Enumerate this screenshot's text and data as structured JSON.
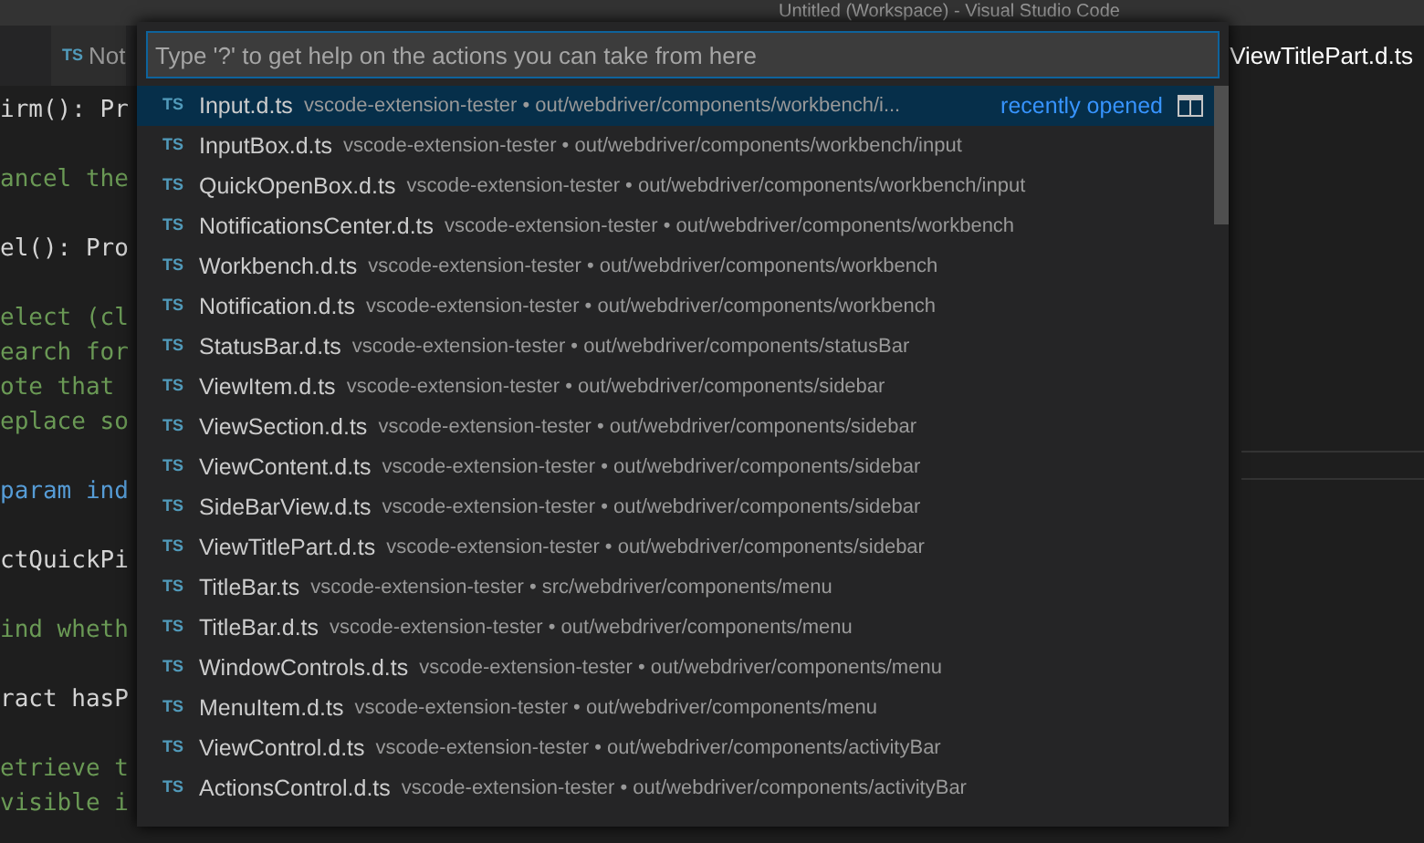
{
  "window": {
    "title": "Untitled (Workspace) - Visual Studio Code"
  },
  "tabs": [
    {
      "icon": "TS",
      "label": "Not",
      "selected": false
    },
    {
      "label": "ViewTitlePart.d.ts",
      "selected": true
    }
  ],
  "editor": {
    "blocks": [
      [
        {
          "text": "irm(): Pr",
          "kind": "code"
        }
      ],
      [
        {
          "text": "ancel the",
          "kind": "comment"
        }
      ],
      [
        {
          "text": "el(): Pro",
          "kind": "code"
        }
      ],
      [
        {
          "text": "elect (cl",
          "kind": "comment"
        },
        {
          "text": "earch for",
          "kind": "comment"
        },
        {
          "text": "ote that",
          "kind": "comment"
        },
        {
          "text": "eplace so",
          "kind": "comment"
        }
      ],
      [
        {
          "text": "param ind",
          "kind": "jsdoc"
        }
      ],
      [
        {
          "text": "ctQuickPi",
          "kind": "code"
        }
      ],
      [
        {
          "text": "ind wheth",
          "kind": "comment"
        }
      ],
      [
        {
          "text": "ract hasP",
          "kind": "code"
        }
      ],
      [
        {
          "text": "etrieve t",
          "kind": "comment"
        },
        {
          "text": "visible i",
          "kind": "comment"
        }
      ]
    ]
  },
  "quick_open": {
    "placeholder": "Type '?' to get help on the actions you can take from here",
    "items": [
      {
        "icon": "TS",
        "name": "Input.d.ts",
        "description": "vscode-extension-tester • out/webdriver/components/workbench/i...",
        "detail": "recently opened",
        "selected": true
      },
      {
        "icon": "TS",
        "name": "InputBox.d.ts",
        "description": "vscode-extension-tester • out/webdriver/components/workbench/input",
        "selected": false
      },
      {
        "icon": "TS",
        "name": "QuickOpenBox.d.ts",
        "description": "vscode-extension-tester • out/webdriver/components/workbench/input",
        "selected": false
      },
      {
        "icon": "TS",
        "name": "NotificationsCenter.d.ts",
        "description": "vscode-extension-tester • out/webdriver/components/workbench",
        "selected": false
      },
      {
        "icon": "TS",
        "name": "Workbench.d.ts",
        "description": "vscode-extension-tester • out/webdriver/components/workbench",
        "selected": false
      },
      {
        "icon": "TS",
        "name": "Notification.d.ts",
        "description": "vscode-extension-tester • out/webdriver/components/workbench",
        "selected": false
      },
      {
        "icon": "TS",
        "name": "StatusBar.d.ts",
        "description": "vscode-extension-tester • out/webdriver/components/statusBar",
        "selected": false
      },
      {
        "icon": "TS",
        "name": "ViewItem.d.ts",
        "description": "vscode-extension-tester • out/webdriver/components/sidebar",
        "selected": false
      },
      {
        "icon": "TS",
        "name": "ViewSection.d.ts",
        "description": "vscode-extension-tester • out/webdriver/components/sidebar",
        "selected": false
      },
      {
        "icon": "TS",
        "name": "ViewContent.d.ts",
        "description": "vscode-extension-tester • out/webdriver/components/sidebar",
        "selected": false
      },
      {
        "icon": "TS",
        "name": "SideBarView.d.ts",
        "description": "vscode-extension-tester • out/webdriver/components/sidebar",
        "selected": false
      },
      {
        "icon": "TS",
        "name": "ViewTitlePart.d.ts",
        "description": "vscode-extension-tester • out/webdriver/components/sidebar",
        "selected": false
      },
      {
        "icon": "TS",
        "name": "TitleBar.ts",
        "description": "vscode-extension-tester • src/webdriver/components/menu",
        "selected": false
      },
      {
        "icon": "TS",
        "name": "TitleBar.d.ts",
        "description": "vscode-extension-tester • out/webdriver/components/menu",
        "selected": false
      },
      {
        "icon": "TS",
        "name": "WindowControls.d.ts",
        "description": "vscode-extension-tester • out/webdriver/components/menu",
        "selected": false
      },
      {
        "icon": "TS",
        "name": "MenuItem.d.ts",
        "description": "vscode-extension-tester • out/webdriver/components/menu",
        "selected": false
      },
      {
        "icon": "TS",
        "name": "ViewControl.d.ts",
        "description": "vscode-extension-tester • out/webdriver/components/activityBar",
        "selected": false
      },
      {
        "icon": "TS",
        "name": "ActionsControl.d.ts",
        "description": "vscode-extension-tester • out/webdriver/components/activityBar",
        "selected": false
      }
    ]
  }
}
